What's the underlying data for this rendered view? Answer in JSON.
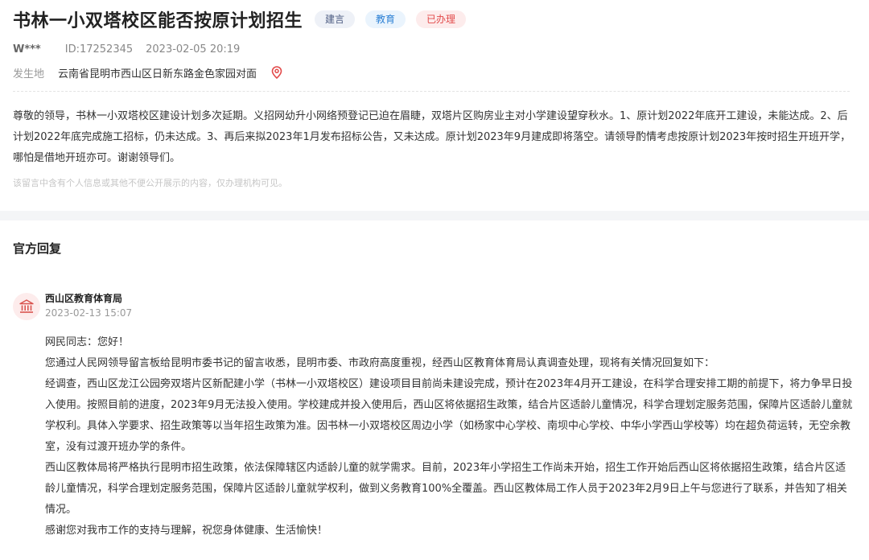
{
  "message": {
    "title": "书林一小双塔校区能否按原计划招生",
    "tags": {
      "type": "建言",
      "domain": "教育",
      "status": "已办理"
    },
    "user": "W***",
    "id": "ID:17252345",
    "datetime": "2023-02-05 20:19",
    "location_label": "发生地",
    "location": "云南省昆明市西山区日新东路金色家园对面",
    "location_icon": "map-pin-icon",
    "body": "尊敬的领导，书林一小双塔校区建设计划多次延期。义招网幼升小网络预登记已迫在眉睫，双塔片区购房业主对小学建设望穿秋水。1、原计划2022年底开工建设，未能达成。2、后计划2022年底完成施工招标，仍未达成。3、再后来拟2023年1月发布招标公告，又未达成。原计划2023年9月建成即将落空。请领导酌情考虑按原计划2023年按时招生开班开学，哪怕是借地开班亦可。谢谢领导们。",
    "privacy_notice": "该留言中含有个人信息或其他不便公开展示的内容，仅办理机构可见。"
  },
  "reply_section": {
    "title": "官方回复",
    "org_name": "西山区教育体育局",
    "org_icon": "government-building-icon",
    "time": "2023-02-13 15:07",
    "paragraphs": [
      "网民同志：您好！",
      "您通过人民网领导留言板给昆明市委书记的留言收悉，昆明市委、市政府高度重视，经西山区教育体育局认真调查处理，现将有关情况回复如下：",
      "经调查，西山区龙江公园旁双塔片区新配建小学（书林一小双塔校区）建设项目目前尚未建设完成，预计在2023年4月开工建设，在科学合理安排工期的前提下，将力争早日投入使用。按照目前的进度，2023年9月无法投入使用。学校建成并投入使用后，西山区将依据招生政策，结合片区适龄儿童情况，科学合理划定服务范围，保障片区适龄儿童就学权利。具体入学要求、招生政策等以当年招生政策为准。因书林一小双塔校区周边小学（如杨家中心学校、南坝中心学校、中华小学西山学校等）均在超负荷运转，无空余教室，没有过渡开班办学的条件。",
      "西山区教体局将严格执行昆明市招生政策，依法保障辖区内适龄儿童的就学需求。目前，2023年小学招生工作尚未开始，招生工作开始后西山区将依据招生政策，结合片区适龄儿童情况，科学合理划定服务范围，保障片区适龄儿童就学权利，做到义务教育100%全覆盖。西山区教体局工作人员于2023年2月9日上午与您进行了联系，并告知了相关情况。",
      "感谢您对我市工作的支持与理解，祝您身体健康、生活愉快！"
    ]
  },
  "colors": {
    "accent_red": "#e24a4a",
    "accent_blue": "#2a7fd4"
  }
}
